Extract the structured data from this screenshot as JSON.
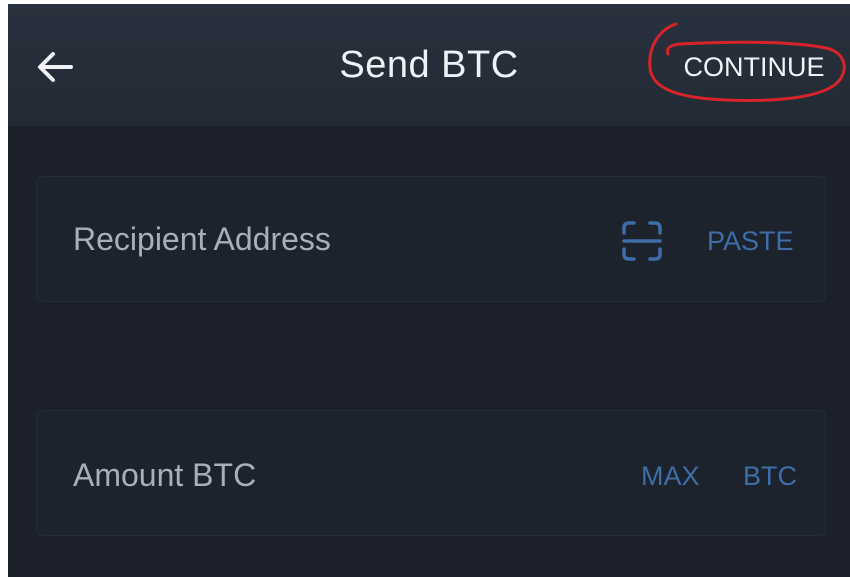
{
  "header": {
    "title": "Send BTC",
    "continue_label": "CONTINUE",
    "back_icon": "arrow-left-icon"
  },
  "recipient": {
    "placeholder": "Recipient Address",
    "scan_icon": "qr-scan-icon",
    "paste_label": "PASTE"
  },
  "amount": {
    "placeholder": "Amount BTC",
    "max_label": "MAX",
    "unit_label": "BTC"
  },
  "colors": {
    "background": "#1b202a",
    "header": "#262e3a",
    "accent": "#3e6da8",
    "annotation": "#d8232a"
  }
}
